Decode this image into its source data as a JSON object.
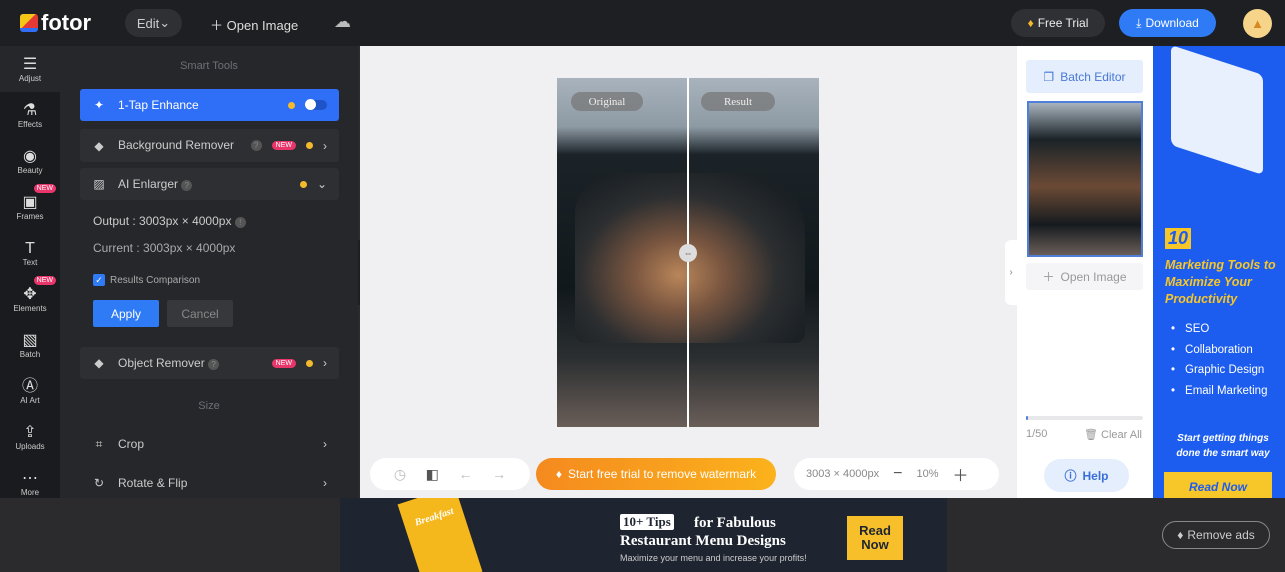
{
  "header": {
    "logo": "fotor",
    "edit": "Edit",
    "open_image": "Open Image",
    "free_trial": "Free Trial",
    "download": "Download"
  },
  "rail": [
    {
      "label": "Adjust",
      "icon": "sliders-icon"
    },
    {
      "label": "Effects",
      "icon": "flask-icon"
    },
    {
      "label": "Beauty",
      "icon": "eye-icon"
    },
    {
      "label": "Frames",
      "icon": "frame-icon",
      "badge": "NEW"
    },
    {
      "label": "Text",
      "icon": "text-icon"
    },
    {
      "label": "Elements",
      "icon": "shapes-icon",
      "badge": "NEW"
    },
    {
      "label": "Batch",
      "icon": "batch-icon"
    },
    {
      "label": "AI Art",
      "icon": "ai-icon"
    },
    {
      "label": "Uploads",
      "icon": "upload-icon"
    },
    {
      "label": "More",
      "icon": "more-icon"
    }
  ],
  "panel": {
    "smart_tools": "Smart Tools",
    "one_tap": "1-Tap Enhance",
    "bg_remover": "Background Remover",
    "ai_enlarger": "AI Enlarger",
    "new_badge": "NEW",
    "output": "Output : 3003px × 4000px",
    "current": "Current : 3003px × 4000px",
    "results_comparison": "Results Comparison",
    "results_comparison_checked": true,
    "apply": "Apply",
    "cancel": "Cancel",
    "object_remover": "Object Remover",
    "size": "Size",
    "crop": "Crop",
    "rotate": "Rotate & Flip"
  },
  "canvas": {
    "original": "Original",
    "result": "Result",
    "watermark_cta": "Start free trial to remove watermark",
    "dimensions": "3003 × 4000px",
    "zoom": "10%"
  },
  "right_panel": {
    "batch_editor": "Batch Editor",
    "open_image": "Open Image",
    "count": "1/50",
    "clear_all": "Clear All",
    "help": "Help",
    "progress": 0.02
  },
  "ad": {
    "number": "10",
    "title": "Marketing Tools to Maximize Your Productivity",
    "items": [
      "SEO",
      "Collaboration",
      "Graphic Design",
      "Email Marketing"
    ],
    "tagline": "Start getting things done the smart way",
    "cta": "Read Now"
  },
  "banner": {
    "tips": "10+ Tips",
    "for": "for Fabulous",
    "title": "Restaurant Menu Designs",
    "sub": "Maximize your menu and increase your profits!",
    "cta": "Read Now",
    "menu_text": "Breakfast"
  },
  "remove_ads": "Remove ads",
  "colors": {
    "accent": "#2f6ef7",
    "ad_blue": "#1c5df0",
    "ad_yellow": "#f7c628",
    "watermark_orange": "#f58a1f"
  }
}
